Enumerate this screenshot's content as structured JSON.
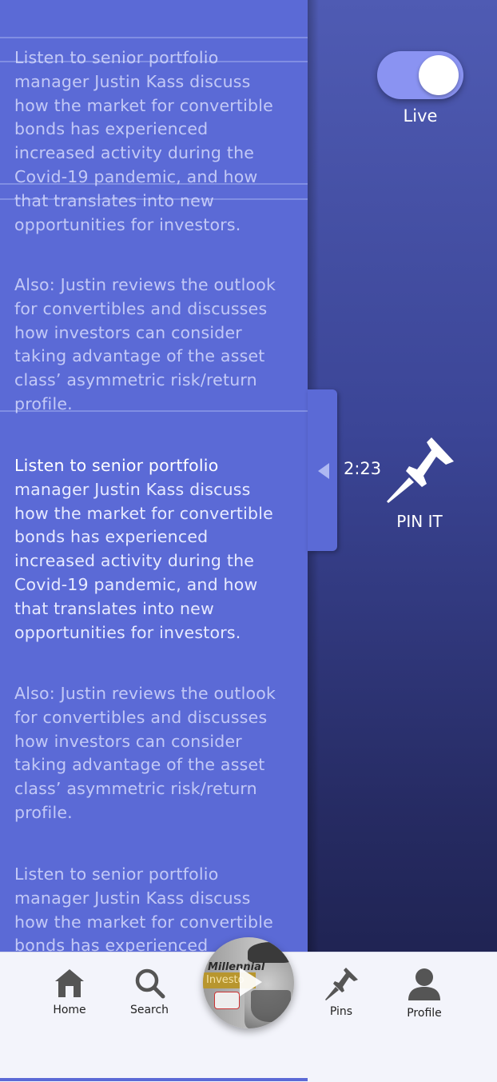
{
  "toggle": {
    "label": "Live",
    "on": true
  },
  "player_side": {
    "time": "2:23",
    "pin_label": "PIN IT"
  },
  "transcript": {
    "p1": "Listen to senior portfolio manager Justin Kass discuss how the market for convertible bonds has experienced increased activity during the Covid-19 pandemic, and how that translates into new opportunities for investors.",
    "p2": "Also: Justin reviews the outlook for convertibles and discusses how investors can consider taking advantage of the asset class’ asymmetric risk/return profile.",
    "p3_highlight": "Listen to senior portfolio",
    "p3_rest": "manager Justin Kass discuss how the market for convertible bonds has experienced increased activity during the Covid-19 pandemic, and how that translates into new opportunities for investors.",
    "p4": "Also: Justin reviews the outlook for convertibles and discusses how investors can consider taking advantage of the asset class’ asymmetric risk/return profile.",
    "p5": "Listen to senior portfolio manager Justin Kass discuss how the market for convertible bonds has experienced"
  },
  "tabbar": {
    "home": "Home",
    "search": "Search",
    "pins": "Pins",
    "profile": "Profile"
  },
  "now_playing": {
    "cover_text_1": "Millennial",
    "cover_text_2": "Investo"
  },
  "colors": {
    "panel": "#5b6ad6",
    "toggle_track": "#8a93f2",
    "tab_icon": "#555555"
  }
}
